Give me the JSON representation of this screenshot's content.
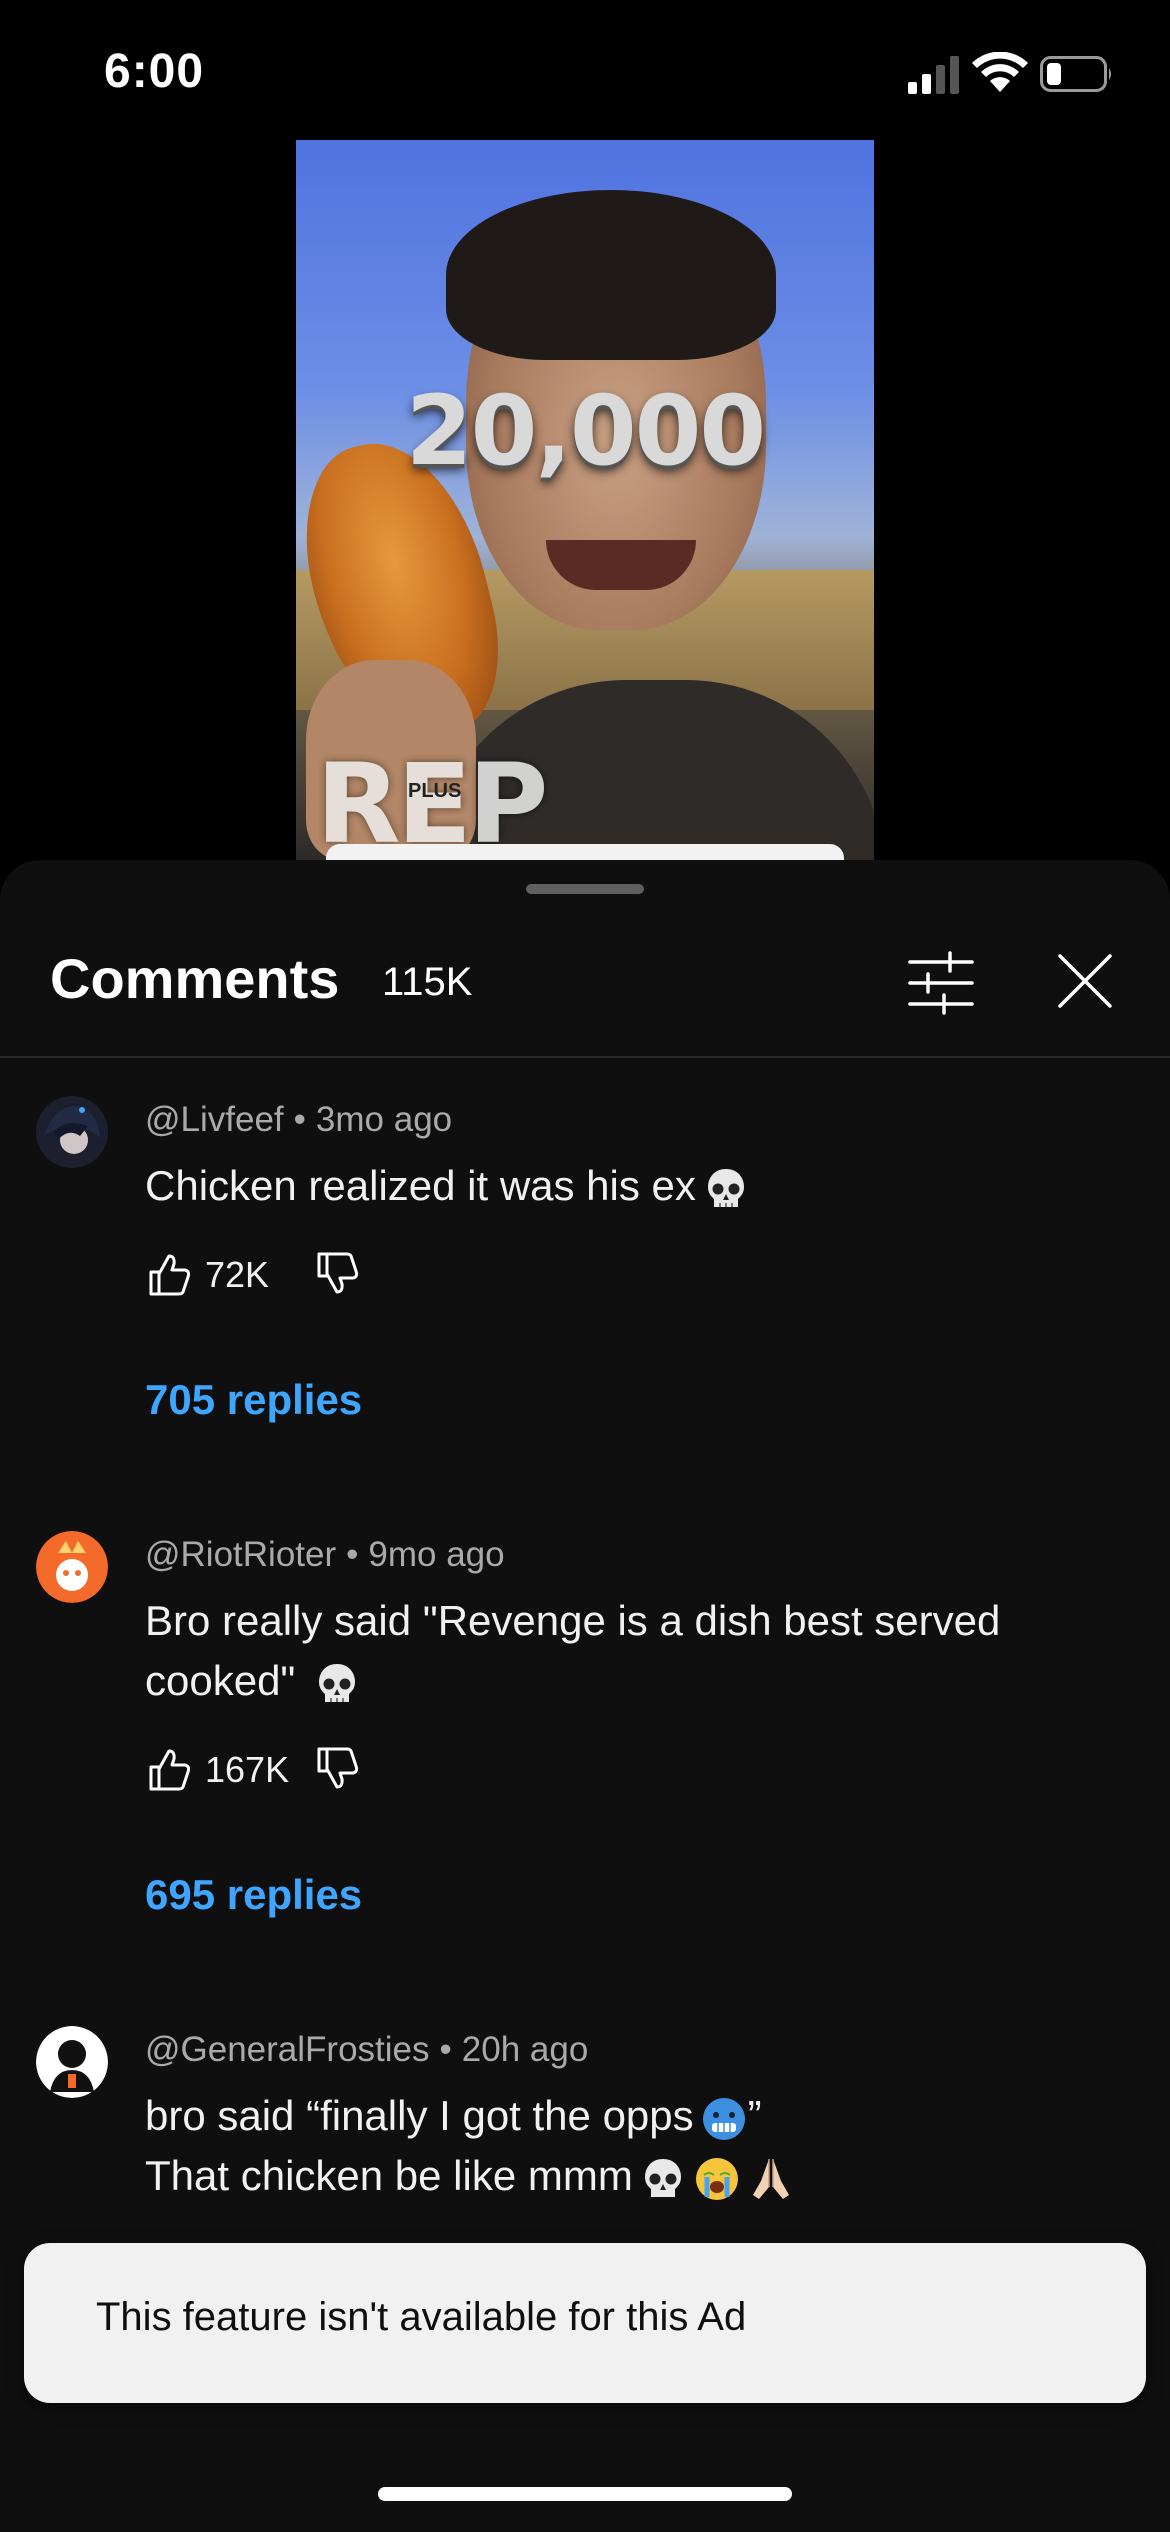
{
  "status_bar": {
    "time": "6:00"
  },
  "video": {
    "overlay_number": "20,000",
    "overlay_word": "REP",
    "overlay_small": "PLUS"
  },
  "comments_panel": {
    "title": "Comments",
    "count": "115K"
  },
  "comments": [
    {
      "handle": "@Livfeef",
      "age": "3mo ago",
      "text": "Chicken realized it was his ex",
      "emojis": [
        "skull"
      ],
      "likes": "72K",
      "replies": "705 replies"
    },
    {
      "handle": "@RiotRioter",
      "age": "9mo ago",
      "text_line1": "Bro really said \"Revenge is a dish best served",
      "text_line2": "cooked\"",
      "emojis": [
        "skull"
      ],
      "likes": "167K",
      "replies": "695 replies"
    },
    {
      "handle": "@GeneralFrosties",
      "age": "20h ago",
      "text_line1": "bro said “finally I got the opps",
      "text_line1_end": "”",
      "text_line2": "That chicken be like mmm",
      "emojis": [
        "cold-face",
        "skull",
        "crying-face",
        "folded-hands"
      ]
    }
  ],
  "toast": {
    "message": "This feature isn't available for this Ad"
  }
}
